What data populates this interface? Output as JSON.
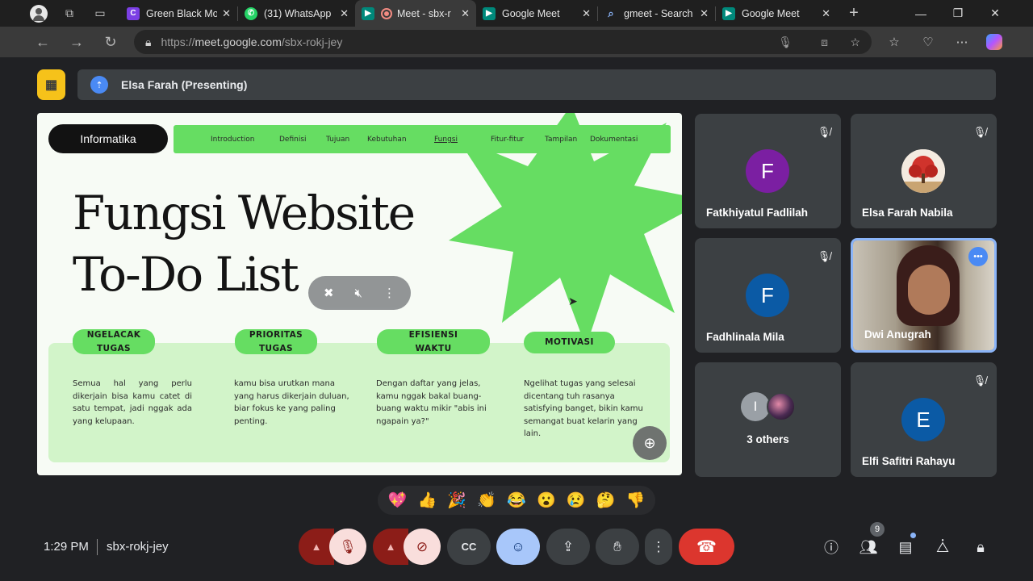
{
  "browser": {
    "tabs": [
      {
        "title": "Green Black Mode",
        "icon": "canva-icon",
        "color": "#7b3fe4"
      },
      {
        "title": "(31) WhatsApp",
        "icon": "whatsapp-icon",
        "color": "#25d366"
      },
      {
        "title": "Meet - sbx-r",
        "icon": "meet-icon",
        "color": "#00897b",
        "active": true
      },
      {
        "title": "Google Meet",
        "icon": "meet-icon",
        "color": "#00897b"
      },
      {
        "title": "gmeet - Search",
        "icon": "search-icon",
        "color": "#4a8af4"
      },
      {
        "title": "Google Meet",
        "icon": "meet-icon",
        "color": "#00897b"
      }
    ],
    "url_prefix": "https://",
    "url_host": "meet.google.com",
    "url_path": "/sbx-rokj-jey"
  },
  "presenter": {
    "label": "Elsa Farah (Presenting)"
  },
  "slide": {
    "pill": "Informatika",
    "nav": [
      "Introduction",
      "Definisi",
      "Tujuan",
      "Kebutuhan",
      "Fungsi",
      "Fitur-fitur",
      "Tampilan",
      "Dokumentasi"
    ],
    "title_line1": "Fungsi Website",
    "title_line2": "To-Do List",
    "columns": [
      {
        "label": "NGELACAK TUGAS",
        "body": "Semua hal yang perlu dikerjain bisa kamu catet di satu tempat, jadi nggak ada yang kelupaan."
      },
      {
        "label": "PRIORITAS TUGAS",
        "body": "kamu bisa urutkan mana yang harus dikerjain duluan, biar fokus ke yang paling penting."
      },
      {
        "label": "EFISIENSI WAKTU",
        "body": "Dengan daftar yang jelas, kamu nggak bakal buang-buang waktu mikir \"abis ini ngapain ya?\""
      },
      {
        "label": "MOTIVASI",
        "body": "Ngelihat tugas yang selesai dicentang tuh rasanya satisfying banget, bikin kamu semangat buat kelarin yang lain."
      }
    ],
    "accent": "#66dd62"
  },
  "participants": [
    {
      "name": "Fatkhiyatul Fadlilah",
      "initial": "F",
      "color": "#7b1fa2",
      "muted": true
    },
    {
      "name": "Elsa Farah Nabila",
      "initial": "",
      "color": "#f1e2d3",
      "muted": true
    },
    {
      "name": "Fadhlinala Mila",
      "initial": "F",
      "color": "#0b5aa5",
      "muted": true
    },
    {
      "name": "Dwi Anugrah",
      "initial": "",
      "color": "#8ab4f8",
      "muted": false,
      "speaking": true
    },
    {
      "name": "3 others",
      "initial": "I",
      "color": "#9aa0a6",
      "muted": false
    },
    {
      "name": "Elfi Safitri Rahayu",
      "initial": "E",
      "color": "#0b5aa5",
      "muted": true
    }
  ],
  "reactions": [
    "💖",
    "👍",
    "🎉",
    "👏",
    "😂",
    "😮",
    "😢",
    "🤔",
    "👎"
  ],
  "controls": {
    "time": "1:29 PM",
    "meeting_code": "sbx-rokj-jey",
    "participant_count": "9"
  }
}
